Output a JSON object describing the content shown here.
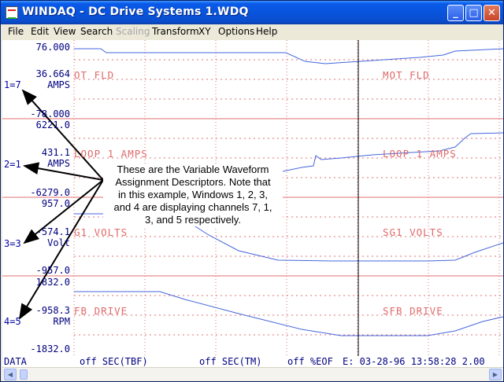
{
  "window": {
    "title": "WINDAQ - DC Drive Systems 1.WDQ"
  },
  "titlebar_buttons": {
    "minimize": "_",
    "maximize": "□",
    "close": "✕"
  },
  "menu": [
    {
      "label": "File",
      "disabled": false
    },
    {
      "label": "Edit",
      "disabled": false
    },
    {
      "label": "View",
      "disabled": false
    },
    {
      "label": "Search",
      "disabled": false
    },
    {
      "label": "Scaling",
      "disabled": true
    },
    {
      "label": "Transform",
      "disabled": false
    },
    {
      "label": "XY",
      "disabled": false
    },
    {
      "label": "Options",
      "disabled": false
    },
    {
      "label": "Help",
      "disabled": false
    }
  ],
  "channels": [
    {
      "descriptor": "1=7",
      "top": "76.000",
      "mid": "36.664",
      "unit": "AMPS",
      "bottom": "-78.000",
      "name_left": "OT FLD",
      "name_right": "MOT FLD"
    },
    {
      "descriptor": "2=1",
      "top": "6221.0",
      "mid": "431.1",
      "unit": "AMPS",
      "bottom": "-6279.0",
      "name_left": "LOOP 1 AMPS",
      "name_right": "LOOP 1 AMPS"
    },
    {
      "descriptor": "3=3",
      "top": "957.0",
      "mid": "-574.1",
      "unit": "Volt",
      "bottom": "-957.0",
      "name_left": "G1 VOLTS",
      "name_right": "SG1 VOLTS"
    },
    {
      "descriptor": "4=5",
      "top": "1832.0",
      "mid": "-958.3",
      "unit": "RPM",
      "bottom": "-1832.0",
      "name_left": "FB DRIVE",
      "name_right": "SFB DRIVE"
    }
  ],
  "annotation": {
    "lines": [
      "These are the Variable Waveform",
      "Assignment Descriptors. Note that",
      "in this example, Windows 1, 2, 3,",
      "and 4 are displaying channels 7, 1,",
      "3, and 5 respectively."
    ]
  },
  "status": {
    "mode": "DATA",
    "tbf": "off SEC(TBF)",
    "tm": "off SEC(TM)",
    "eof": "off %EOF",
    "event": "E: 03-28-96 13:58:28 2.00"
  },
  "colors": {
    "waveform": "#4466dd",
    "grid": "#e07070",
    "text_axis": "#000080",
    "cursor": "#000000"
  }
}
